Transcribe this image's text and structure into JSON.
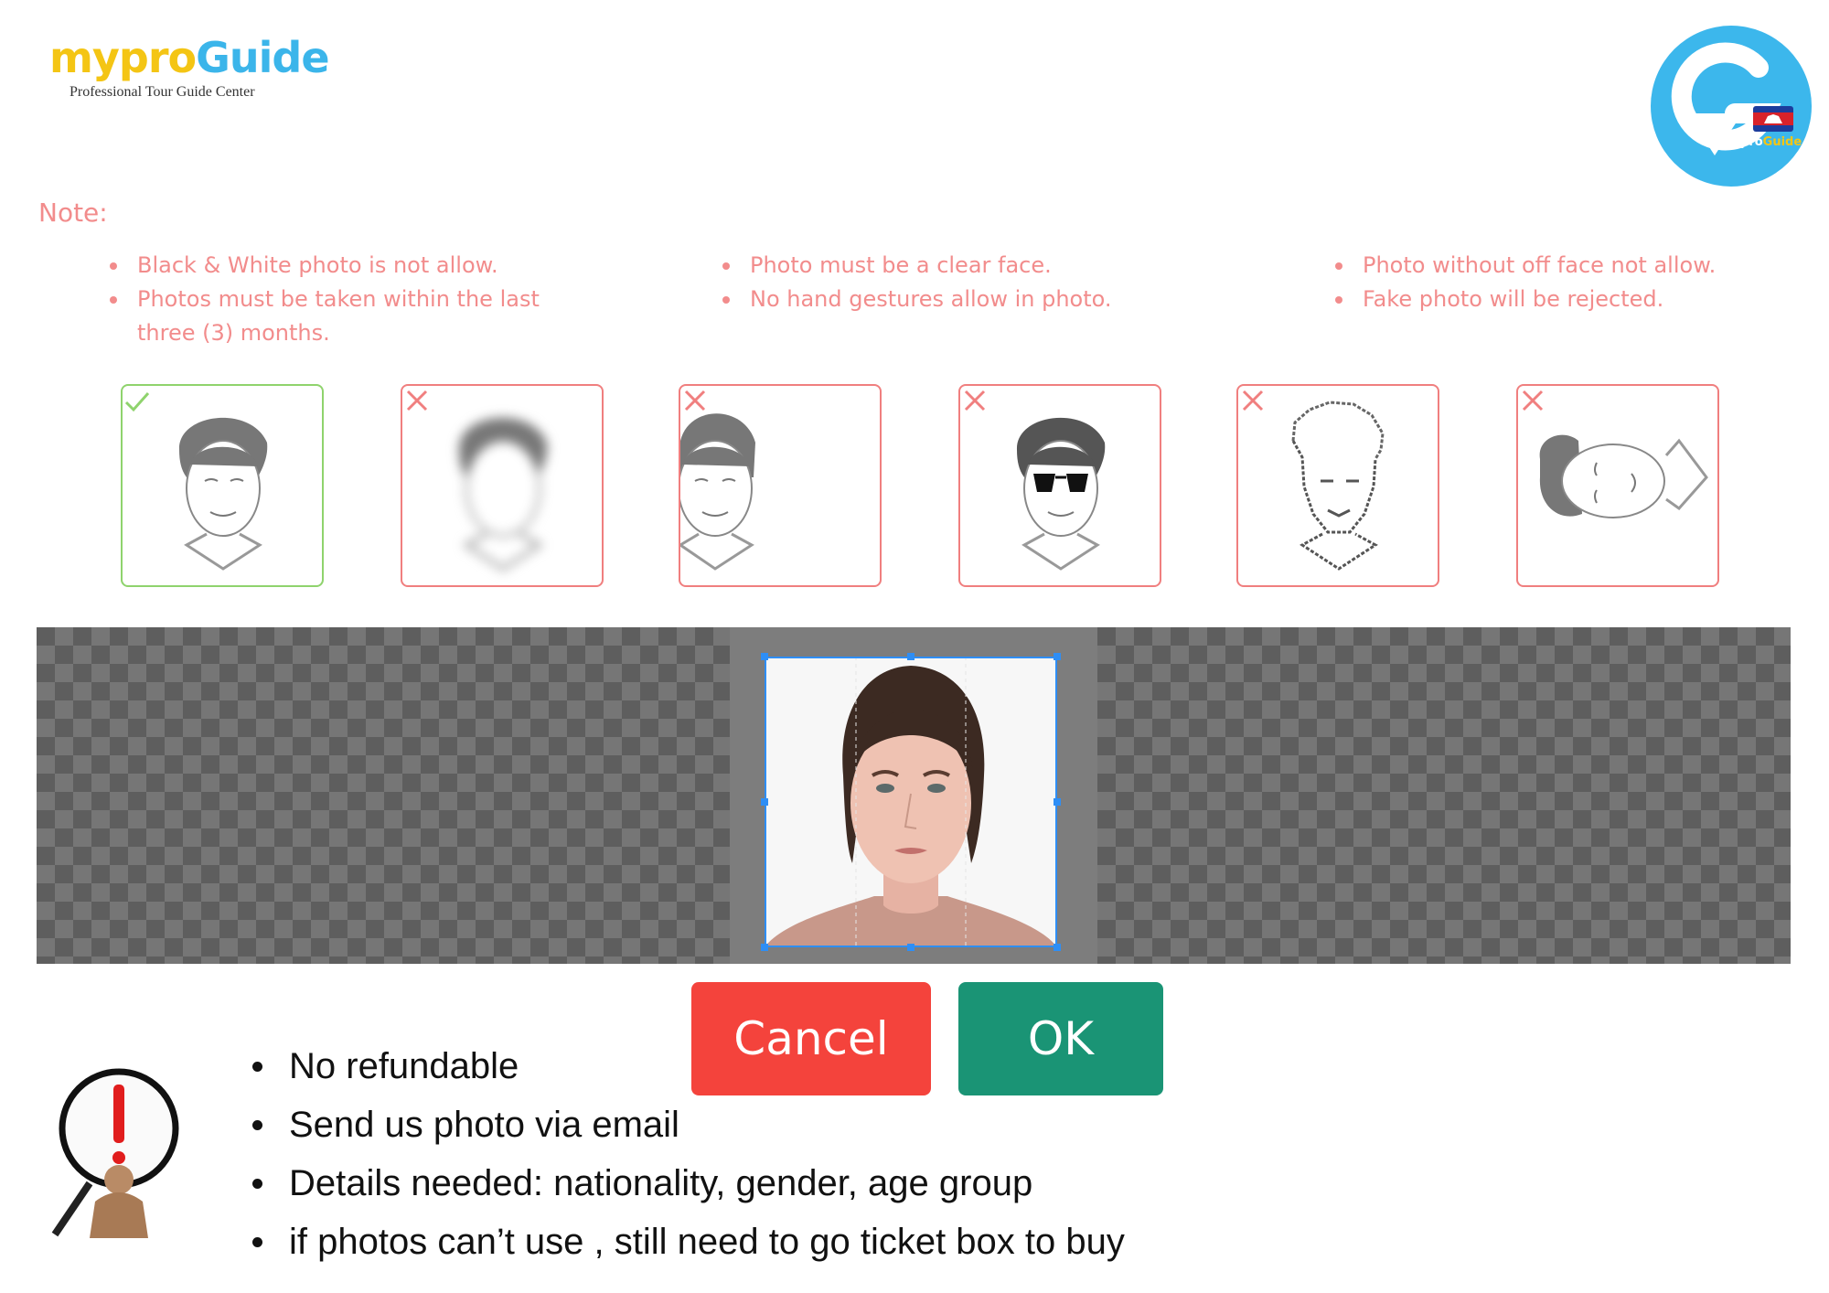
{
  "logo": {
    "text_part1": "mypro",
    "text_part2": "Guide",
    "tagline": "Professional Tour Guide Center",
    "badge_text_part1": "mypro",
    "badge_text_part2": "Guide"
  },
  "note": {
    "title": "Note:",
    "columns": [
      [
        "Black & White photo is not allow.",
        "Photos must be taken within the last three (3) months."
      ],
      [
        "Photo must be a clear face.",
        "No hand gestures allow in photo."
      ],
      [
        "Photo without off face not allow.",
        "Fake photo will be rejected."
      ]
    ]
  },
  "examples": [
    {
      "icon": "face-ok-icon",
      "status": "accepted"
    },
    {
      "icon": "face-blurred-icon",
      "status": "rejected"
    },
    {
      "icon": "face-cropped-icon",
      "status": "rejected"
    },
    {
      "icon": "face-sunglasses-icon",
      "status": "rejected"
    },
    {
      "icon": "face-pixelated-icon",
      "status": "rejected"
    },
    {
      "icon": "face-tilted-icon",
      "status": "rejected"
    }
  ],
  "buttons": {
    "cancel_label": "Cancel",
    "ok_label": "OK"
  },
  "bullets": [
    "No refundable",
    "Send us photo via email",
    "Details needed: nationality, gender, age group",
    "if photos can’t use , still need to go ticket box to buy"
  ],
  "colors": {
    "note_text": "#f28c8c",
    "accepted_border": "#8fd36d",
    "rejected_border": "#f07f7f",
    "cancel_button": "#f4433c",
    "ok_button": "#1a9475",
    "crop_frame": "#2e8ef5",
    "brand_blue": "#3bb5ea",
    "brand_yellow": "#f4c514"
  }
}
